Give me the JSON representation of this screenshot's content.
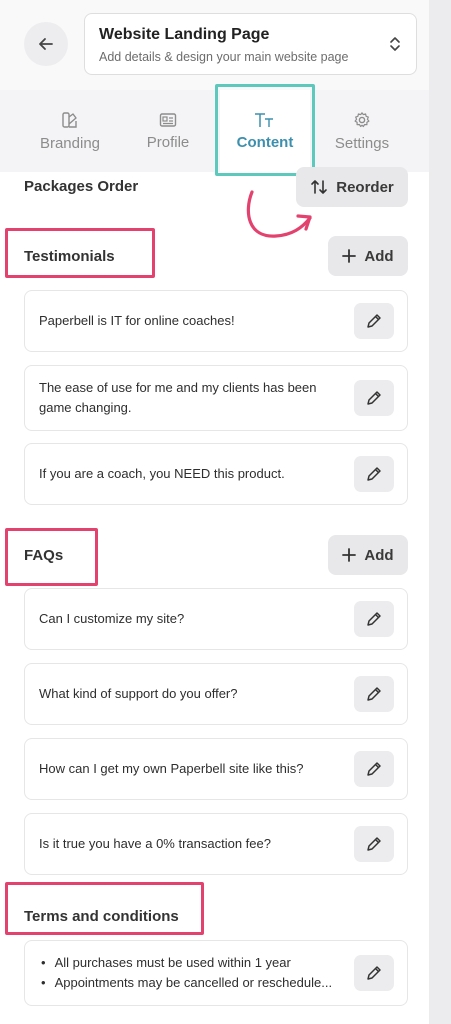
{
  "header": {
    "title": "Website Landing Page",
    "subtitle": "Add details & design your main website page",
    "back_icon": "arrow-left-icon",
    "select_icon": "chevron-up-down-icon"
  },
  "tabs": [
    {
      "label": "Branding",
      "icon": "palette-icon",
      "active": false
    },
    {
      "label": "Profile",
      "icon": "id-card-icon",
      "active": false
    },
    {
      "label": "Content",
      "icon": "text-size-icon",
      "active": true
    },
    {
      "label": "Settings",
      "icon": "gear-icon",
      "active": false
    }
  ],
  "packages": {
    "title": "Packages Order",
    "reorder_label": "Reorder"
  },
  "testimonials": {
    "title": "Testimonials",
    "add_label": "Add",
    "items": [
      "Paperbell is IT for online coaches!",
      "The ease of use for me and my clients has been game changing.",
      "If you are a coach, you NEED this product."
    ]
  },
  "faqs": {
    "title": "FAQs",
    "add_label": "Add",
    "items": [
      "Can I customize my site?",
      "What kind of support do you offer?",
      "How can I get my own Paperbell site like this?",
      "Is it true you have a 0% transaction fee?"
    ]
  },
  "terms": {
    "title": "Terms and conditions",
    "bullets": [
      "All purchases must be used within 1 year",
      "Appointments may be cancelled  or reschedule..."
    ]
  },
  "colors": {
    "accent": "#3d8fae",
    "highlight_teal": "#5dc9bd",
    "highlight_pink": "#e3426e"
  }
}
